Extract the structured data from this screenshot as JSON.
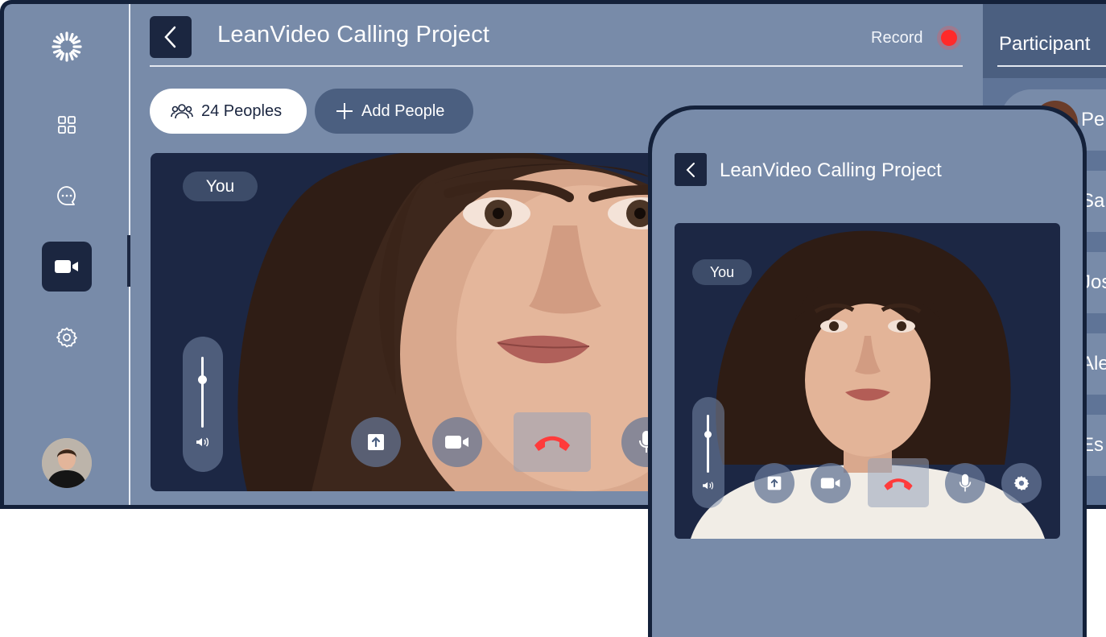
{
  "app": {
    "title": "LeanVideo Calling Project",
    "record_label": "Record"
  },
  "toolbar": {
    "people_count_label": "24 Peoples",
    "add_people_label": "Add People"
  },
  "video": {
    "self_badge": "You"
  },
  "sidebar": {
    "items": [
      {
        "icon": "logo-sunburst-icon"
      },
      {
        "icon": "dashboard-grid-icon"
      },
      {
        "icon": "chat-bubble-icon"
      },
      {
        "icon": "video-camera-icon",
        "active": true
      },
      {
        "icon": "settings-gear-icon"
      }
    ]
  },
  "participants": {
    "title": "Participant",
    "names": [
      "Pe",
      "Sa",
      "Jos",
      "Ale",
      "Es"
    ]
  },
  "phone": {
    "title": "LeanVideo Calling Project",
    "self_badge": "You"
  },
  "colors": {
    "background": "#788ba9",
    "dark": "#1b2640",
    "record": "#ff2a2a",
    "hangup": "#ff3b3b"
  }
}
